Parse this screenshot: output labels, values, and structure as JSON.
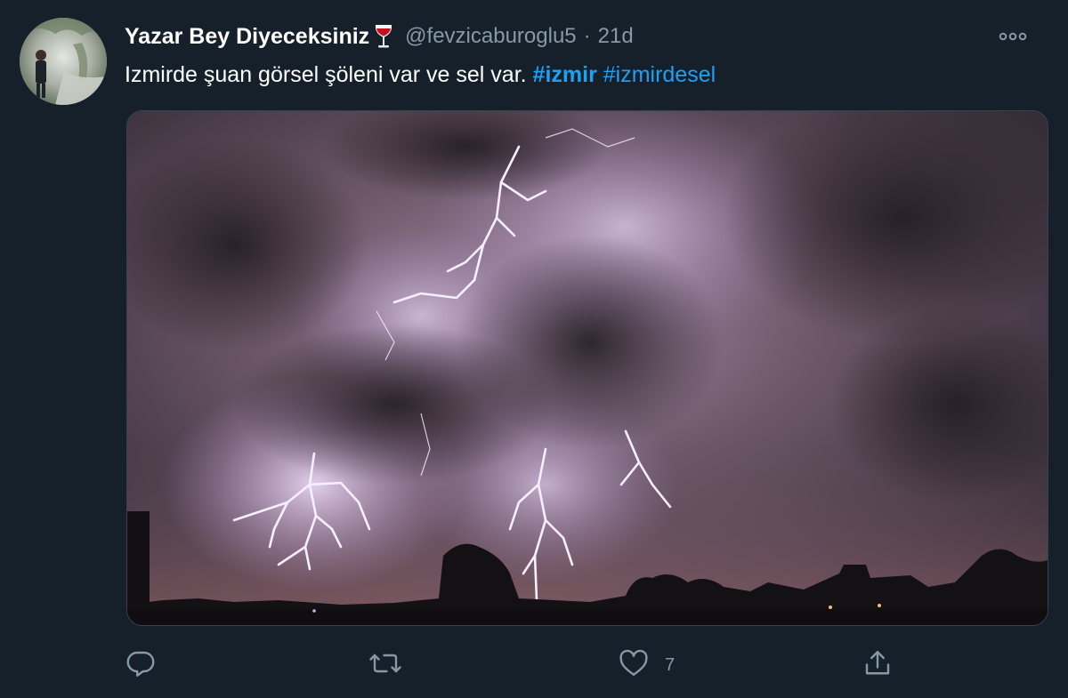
{
  "tweet": {
    "display_name": "Yazar Bey Diyeceksiniz",
    "emoji": "wine-glass-icon",
    "handle": "@fevzicaburoglu5",
    "separator": "·",
    "time": "21d",
    "text_prefix": "Izmirde şuan görsel şöleni var ve sel var.",
    "hashtags": [
      "#izmir",
      "#izmirdesel"
    ],
    "media": "night sky thunderstorm with lightning photo",
    "actions": {
      "reply": {
        "icon": "reply-icon",
        "count": ""
      },
      "retweet": {
        "icon": "retweet-icon",
        "count": ""
      },
      "like": {
        "icon": "heart-icon",
        "count": "7"
      },
      "share": {
        "icon": "share-icon",
        "count": ""
      }
    },
    "more_icon": "more-options-icon"
  },
  "colors": {
    "background": "#15202b",
    "accent": "#1da1f2",
    "secondary_text": "#8899a6",
    "primary_text": "#ffffff"
  }
}
